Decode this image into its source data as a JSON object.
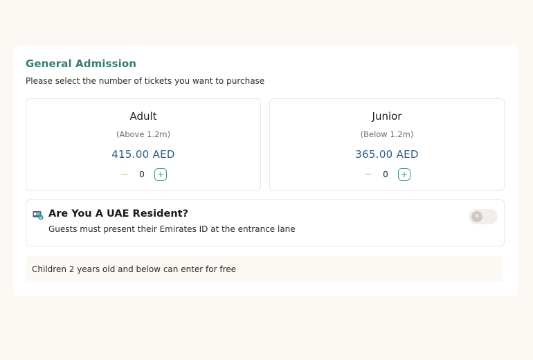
{
  "section": {
    "title": "General Admission",
    "subtitle": "Please select the number of tickets you want to purchase"
  },
  "tickets": [
    {
      "name": "Adult",
      "height": "(Above 1.2m)",
      "price": "415.00 AED",
      "quantity": "0",
      "minus": "−",
      "plus": "+"
    },
    {
      "name": "Junior",
      "height": "(Below 1.2m)",
      "price": "365.00 AED",
      "quantity": "0",
      "minus": "−",
      "plus": "+"
    }
  ],
  "resident": {
    "title": "Are You A UAE Resident?",
    "note": "Guests must present their Emirates ID at the entrance lane",
    "toggle_knob": "✕",
    "toggle_on": false,
    "icon": "id-card-check-icon"
  },
  "free_note": "Children 2 years old and below can enter for free",
  "colors": {
    "accent_teal": "#3a7a72",
    "price_blue": "#2f5e88",
    "background": "#fcf8f4"
  }
}
